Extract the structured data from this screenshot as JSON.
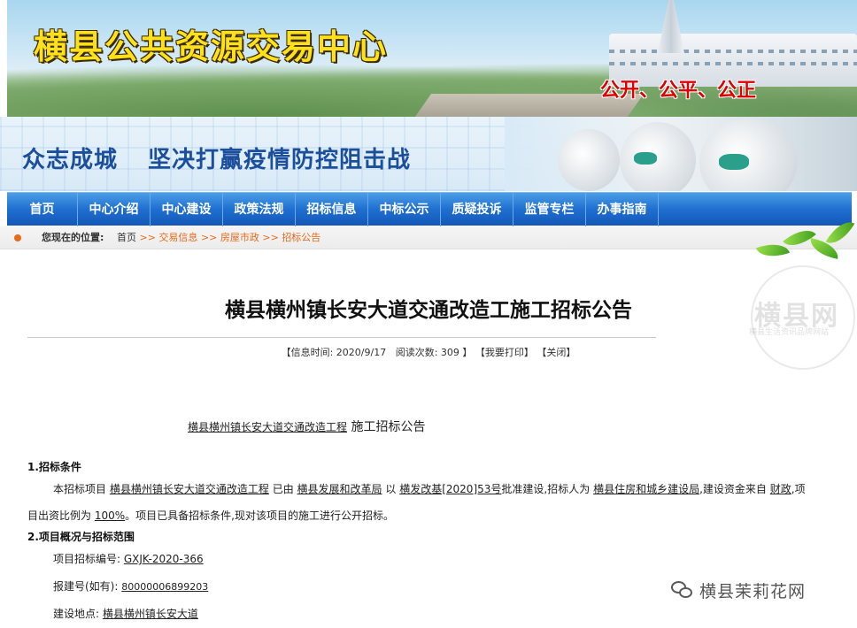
{
  "banner": {
    "title": "横县公共资源交易中心",
    "slogan": "公开、公平、公正"
  },
  "campaign": {
    "line1": "众志成城",
    "line2": "坚决打赢疫情防控阻击战"
  },
  "nav": {
    "items": [
      "首页",
      "中心介绍",
      "中心建设",
      "政策法规",
      "招标信息",
      "中标公示",
      "质疑投诉",
      "监管专栏",
      "办事指南"
    ]
  },
  "breadcrumb": {
    "label": "您现在的位置:",
    "home": "首页",
    "sep": ">>",
    "trail": [
      "交易信息",
      "房屋市政",
      "招标公告"
    ]
  },
  "watermark": {
    "main": "横县网",
    "sub": "横县生活资讯品牌网站"
  },
  "article": {
    "title": "横县横州镇长安大道交通改造工施工招标公告",
    "meta": {
      "time_label": "信息时间:",
      "time_value": "2020/9/17",
      "views_label": "阅读次数:",
      "views_value": "309",
      "print": "我要打印",
      "close": "关闭"
    },
    "subtitle_project": "横县横州镇长安大道交通改造工程",
    "subtitle_rest": "施工招标公告",
    "section1": {
      "heading": "1.招标条件",
      "p1_a": "本招标项目",
      "p1_project": "横县横州镇长安大道交通改造工程",
      "p1_b": "已由",
      "p1_authority": "横县发展和改革局",
      "p1_c": "以",
      "p1_doc": "横发改基[2020]53号",
      "p1_d": "批准建设,招标人为",
      "p1_tenderer": "横县住房和城乡建设局",
      "p1_e": ",建设资金来自",
      "p1_fund": "财政",
      "p1_f": ",项",
      "p2_a": "目出资比例为",
      "p2_ratio": "100%",
      "p2_b": "。项目已具备招标条件,现对该项目的施工进行公开招标。"
    },
    "section2": {
      "heading": "2.项目概况与招标范围",
      "code_label": "项目招标编号:",
      "code_value": "GXJK-2020-366",
      "report_label": "报建号(如有):",
      "report_value": "80000006899203",
      "site_label": "建设地点:",
      "site_value": "横县横州镇长安大道"
    }
  },
  "wechat": {
    "text": "横县茉莉花网"
  }
}
